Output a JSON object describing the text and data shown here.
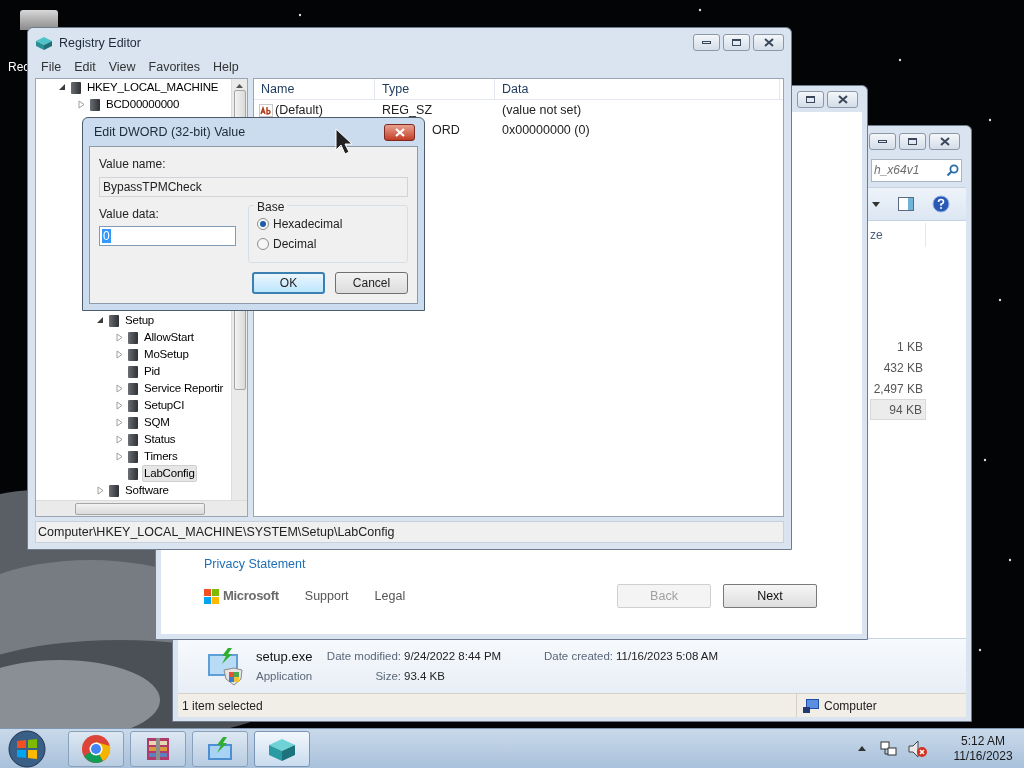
{
  "desktop": {
    "icon_label": "Rec"
  },
  "explorer": {
    "search": {
      "value": "h_x64v1"
    },
    "column_header": "ze",
    "sizes": [
      {
        "text": "1 KB",
        "selected": false
      },
      {
        "text": "432 KB",
        "selected": false
      },
      {
        "text": "2,497 KB",
        "selected": false
      },
      {
        "text": "94 KB",
        "selected": true
      }
    ],
    "details": {
      "file_name": "setup.exe",
      "file_type": "Application",
      "fields": [
        {
          "label": "Date modified:",
          "value": "9/24/2022 8:44 PM"
        },
        {
          "label": "Date created:",
          "value": "11/16/2023 5:08 AM"
        },
        {
          "label": "Size:",
          "value": "93.4 KB"
        }
      ]
    },
    "status_bar": {
      "text": "1 item selected",
      "zone": "Computer"
    }
  },
  "setup": {
    "privacy_link": "Privacy Statement",
    "brand": "Microsoft",
    "links": [
      "Support",
      "Legal"
    ],
    "buttons": [
      {
        "label": "Back",
        "disabled": true
      },
      {
        "label": "Next",
        "disabled": false
      }
    ]
  },
  "registry": {
    "title": "Registry Editor",
    "menu": [
      "File",
      "Edit",
      "View",
      "Favorites",
      "Help"
    ],
    "tree": [
      {
        "label": "HKEY_LOCAL_MACHINE",
        "expanded": true,
        "selected": false,
        "children": [
          {
            "label": "BCD00000000",
            "expanded": false,
            "selected": false
          },
          {
            "kind": "covered",
            "expanded": true,
            "children": [
              {
                "label": "Setup",
                "expanded": true,
                "selected": false,
                "children": [
                  {
                    "label": "AllowStart",
                    "expanded": false,
                    "selected": false
                  },
                  {
                    "label": "MoSetup",
                    "expanded": false,
                    "selected": false
                  },
                  {
                    "label": "Pid",
                    "selected": false
                  },
                  {
                    "label": "Service Reportir",
                    "expanded": false,
                    "selected": false
                  },
                  {
                    "label": "SetupCI",
                    "expanded": false,
                    "selected": false
                  },
                  {
                    "label": "SQM",
                    "expanded": false,
                    "selected": false
                  },
                  {
                    "label": "Status",
                    "expanded": false,
                    "selected": false
                  },
                  {
                    "label": "Timers",
                    "expanded": false,
                    "selected": false
                  },
                  {
                    "label": "LabConfig",
                    "selected": true
                  }
                ]
              },
              {
                "label": "Software",
                "expanded": false,
                "selected": false
              }
            ]
          }
        ]
      }
    ],
    "columns": [
      "Name",
      "Type",
      "Data"
    ],
    "values": [
      {
        "kind": "string",
        "name": "(Default)",
        "type": "REG_SZ",
        "data": "(value not set)"
      },
      {
        "kind": "covered",
        "type": "ORD",
        "data": "0x00000000 (0)"
      }
    ],
    "status_bar": "Computer\\HKEY_LOCAL_MACHINE\\SYSTEM\\Setup\\LabConfig"
  },
  "dialog": {
    "title": "Edit DWORD (32-bit) Value",
    "value_name_label": "Value name:",
    "value_name": "BypassTPMCheck",
    "value_data_label": "Value data:",
    "value_data": "0",
    "base_label": "Base",
    "bases": [
      {
        "label": "Hexadecimal",
        "selected": true
      },
      {
        "label": "Decimal",
        "selected": false
      }
    ],
    "buttons": [
      {
        "label": "OK",
        "default": true
      },
      {
        "label": "Cancel",
        "default": false
      }
    ]
  },
  "taskbar": {
    "apps": [
      {
        "kind": "chrome",
        "active": false
      },
      {
        "kind": "archive",
        "active": false
      },
      {
        "kind": "setup",
        "active": false
      },
      {
        "kind": "registry",
        "active": true
      }
    ],
    "time": "5:12 AM",
    "date": "11/16/2023"
  }
}
